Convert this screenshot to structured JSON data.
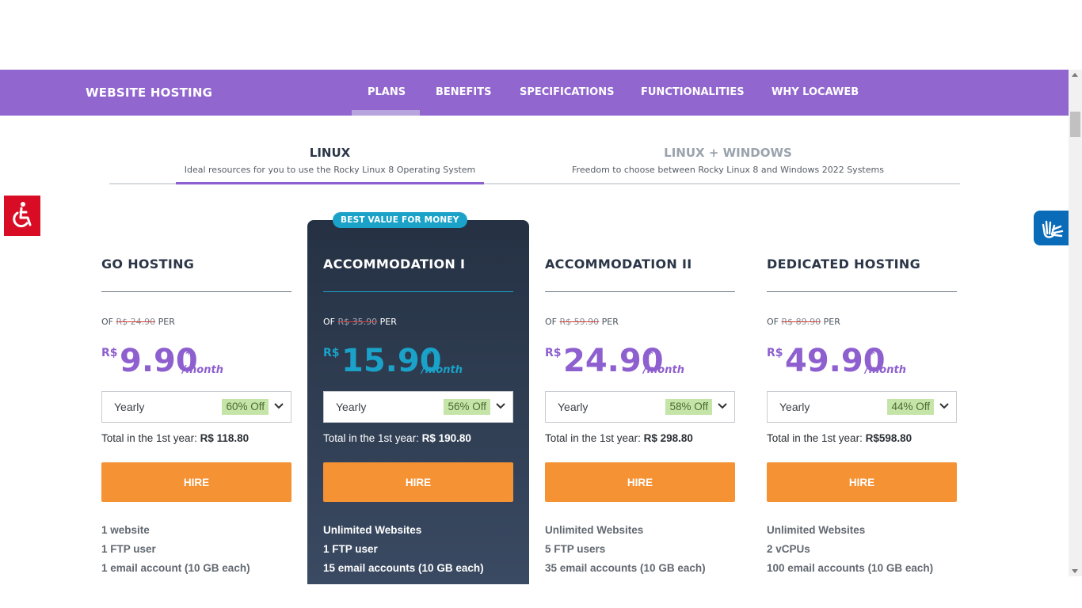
{
  "nav": {
    "brand": "WEBSITE HOSTING",
    "links": [
      "PLANS",
      "BENEFITS",
      "SPECIFICATIONS",
      "FUNCTIONALITIES",
      "WHY LOCAWEB"
    ],
    "active": "PLANS"
  },
  "os_tabs": [
    {
      "title": "LINUX",
      "subtitle": "Ideal resources for you to use the Rocky Linux 8 Operating System",
      "active": true
    },
    {
      "title": "LINUX + WINDOWS",
      "subtitle": "Freedom to choose between Rocky Linux 8 and Windows 2022 Systems",
      "active": false
    }
  ],
  "plans": [
    {
      "name": "GO HOSTING",
      "was_prefix": "OF",
      "was_price": "R$ 24.90",
      "was_suffix": "PER",
      "currency": "R$",
      "price": "9.90",
      "star": "*",
      "period": "/month",
      "billing": "Yearly",
      "discount": "60% Off",
      "total_label": "Total in the 1st year:",
      "total_value": "R$ 118.80",
      "cta": "HIRE",
      "features": [
        "1 website",
        "1 FTP user",
        "1 email account (10 GB each)"
      ]
    },
    {
      "badge": "BEST VALUE FOR MONEY",
      "name": "ACCOMMODATION I",
      "was_prefix": "OF",
      "was_price": "R$ 35.90",
      "was_suffix": "PER",
      "currency": "R$",
      "price": "15.90",
      "star": "*",
      "period": "/month",
      "billing": "Yearly",
      "discount": "56% Off",
      "total_label": "Total in the 1st year:",
      "total_value": "R$ 190.80",
      "cta": "HIRE",
      "features": [
        "Unlimited Websites",
        "1 FTP user",
        "15 email accounts (10 GB each)"
      ]
    },
    {
      "name": "ACCOMMODATION II",
      "was_prefix": "OF",
      "was_price": "R$ 59.90",
      "was_suffix": "PER",
      "currency": "R$",
      "price": "24.90",
      "star": "*",
      "period": "/month",
      "billing": "Yearly",
      "discount": "58% Off",
      "total_label": "Total in the 1st year:",
      "total_value": "R$ 298.80",
      "cta": "HIRE",
      "features": [
        "Unlimited Websites",
        "5 FTP users",
        "35 email accounts (10 GB each)"
      ]
    },
    {
      "name": "DEDICATED HOSTING",
      "was_prefix": "OF",
      "was_price": "R$ 89.90",
      "was_suffix": "PER",
      "currency": "R$",
      "price": "49.90",
      "star": "*",
      "period": "/month",
      "billing": "Yearly",
      "discount": "44% Off",
      "total_label": "Total in the 1st year:",
      "total_value": "R$598.80",
      "cta": "HIRE",
      "features": [
        "Unlimited Websites",
        "2 vCPUs",
        "100 email accounts (10 GB each)"
      ]
    }
  ],
  "colors": {
    "nav_bg": "#9166cf",
    "accent_purple": "#8e5fce",
    "accent_cyan": "#1aa2c9",
    "cta_orange": "#f49234",
    "dark_card": "#253143",
    "discount_bg": "#c5e5a8",
    "accessibility_red": "#d80d25",
    "handtalk_blue": "#0a6cb8"
  },
  "icons": {
    "accessibility": "wheelchair-accessibility-icon",
    "sign_language": "sign-language-hands-icon",
    "dropdown": "chevron-down-icon"
  }
}
